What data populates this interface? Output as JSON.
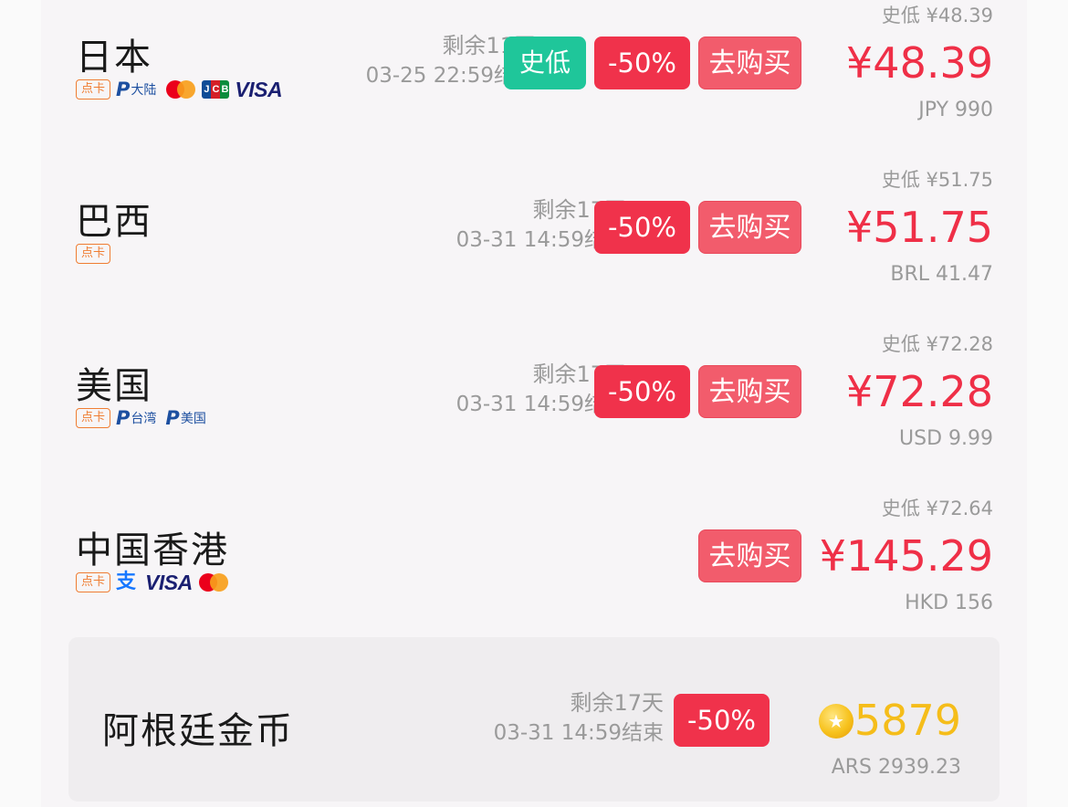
{
  "rows": [
    {
      "name": "日本",
      "payments": {
        "card": "点卡",
        "paypal_label": "大陆",
        "jcb": "JCB",
        "visa": "VISA"
      },
      "remaining": "剩余11天",
      "end_time": "03-25 22:59结束",
      "low_badge": "史低",
      "discount": "-50%",
      "buy": "去购买",
      "hist_low": "史低 ¥48.39",
      "price": "¥48.39",
      "orig_price": "JPY 990"
    },
    {
      "name": "巴西",
      "payments": {
        "card": "点卡"
      },
      "remaining": "剩余17天",
      "end_time": "03-31 14:59结束",
      "discount": "-50%",
      "buy": "去购买",
      "hist_low": "史低 ¥51.75",
      "price": "¥51.75",
      "orig_price": "BRL 41.47"
    },
    {
      "name": "美国",
      "payments": {
        "card": "点卡",
        "paypal_label_1": "台湾",
        "paypal_label_2": "美国"
      },
      "remaining": "剩余17天",
      "end_time": "03-31 14:59结束",
      "discount": "-50%",
      "buy": "去购买",
      "hist_low": "史低 ¥72.28",
      "price": "¥72.28",
      "orig_price": "USD 9.99"
    },
    {
      "name": "中国香港",
      "payments": {
        "card": "点卡",
        "visa": "VISA"
      },
      "buy": "去购买",
      "hist_low": "史低 ¥72.64",
      "price": "¥145.29",
      "orig_price": "HKD 156"
    }
  ],
  "coin_row": {
    "name": "阿根廷金币",
    "remaining": "剩余17天",
    "end_time": "03-31 14:59结束",
    "discount": "-50%",
    "coins": "5879",
    "orig_price": "ARS 2939.23"
  },
  "icons": [
    "paypal-icon",
    "mastercard-icon",
    "jcb-icon",
    "visa-icon",
    "alipay-icon",
    "gold-coin-icon"
  ],
  "colors": {
    "price_red": "#ef2f47",
    "discount_red": "#f0324b",
    "buy_button": "#f25c6c",
    "history_low_green": "#1fc69a",
    "coin_gold": "#f5bd1a",
    "card_badge_orange": "#ef7d32"
  }
}
